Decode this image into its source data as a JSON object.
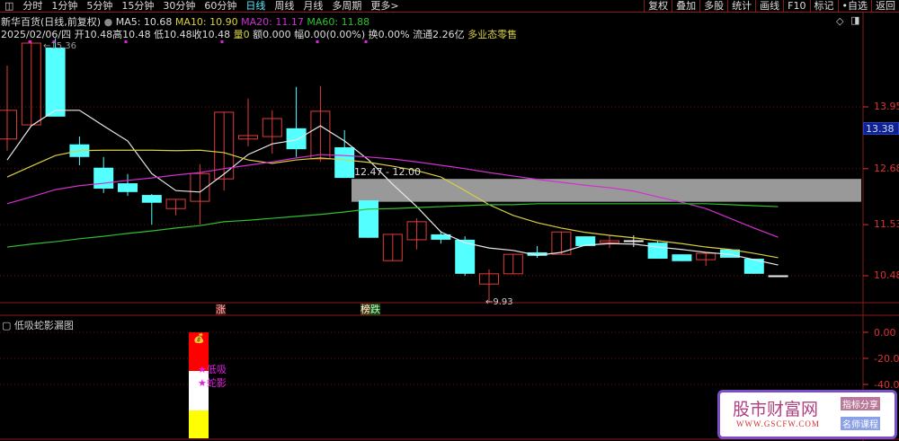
{
  "toolbar": {
    "left": [
      "分时",
      "1分钟",
      "5分钟",
      "15分钟",
      "30分钟",
      "60分钟",
      "日线",
      "周线",
      "月线",
      "多周期",
      "更多>"
    ],
    "active": "日线",
    "right": [
      "复权",
      "叠加",
      "多股",
      "统计",
      "画线",
      "F10",
      "标记",
      "•自选",
      "返回"
    ]
  },
  "header": {
    "title": "新华百货(日线,前复权)",
    "ma5": "MA5: 10.68",
    "ma10": "MA10: 10.90",
    "ma20": "MA20: 11.17",
    "ma60": "MA60: 11.88",
    "date": "2025/02/06/四",
    "open": "开10.48",
    "high": "高10.48",
    "low": "低10.48",
    "close": "收10.48",
    "vol": "量0",
    "amount": "额0.000",
    "range": "幅0.00(0.00%)",
    "turnover": "换0.00%",
    "float": "流通2.26亿",
    "sector": "多业态零售"
  },
  "colors": {
    "up": "#e03c3c",
    "down": "#54ffff",
    "ma5": "#e8e8e8",
    "ma10": "#d8d040",
    "ma20": "#d030d0",
    "ma60": "#30c030",
    "axis": "#d33"
  },
  "chart_data": {
    "type": "candlestick",
    "ylim": [
      9.6,
      15.32
    ],
    "y_ticks": [
      "13.95",
      "12.68",
      "11.53",
      "10.48"
    ],
    "current_price": "13.38",
    "high_label": "15.36",
    "low_label": "9.93",
    "band": {
      "label": "12.47 - 12.00",
      "low": 12.0,
      "high": 12.47
    },
    "ohlc": [
      [
        13.29,
        14.8,
        13.05,
        13.88
      ],
      [
        13.58,
        15.32,
        13.58,
        15.26
      ],
      [
        15.17,
        15.36,
        13.75,
        13.75
      ],
      [
        13.18,
        13.34,
        12.75,
        12.92
      ],
      [
        12.7,
        12.92,
        12.18,
        12.27
      ],
      [
        12.38,
        12.57,
        12.12,
        12.2
      ],
      [
        12.14,
        12.16,
        11.53,
        11.98
      ],
      [
        11.86,
        12.05,
        11.72,
        12.05
      ],
      [
        12.01,
        12.77,
        11.53,
        12.58
      ],
      [
        12.47,
        13.84,
        12.23,
        13.84
      ],
      [
        13.29,
        14.12,
        13.14,
        13.36
      ],
      [
        13.34,
        13.88,
        12.99,
        13.71
      ],
      [
        13.51,
        14.36,
        12.92,
        13.08
      ],
      [
        12.88,
        14.38,
        12.82,
        13.86
      ],
      [
        13.12,
        13.47,
        12.49,
        12.49
      ],
      [
        12.03,
        12.03,
        11.26,
        11.26
      ],
      [
        10.79,
        11.33,
        10.79,
        11.33
      ],
      [
        11.22,
        11.66,
        11.02,
        11.59
      ],
      [
        11.33,
        11.4,
        11.14,
        11.22
      ],
      [
        11.22,
        11.29,
        10.48,
        10.52
      ],
      [
        10.31,
        10.61,
        9.93,
        10.52
      ],
      [
        10.52,
        10.92,
        10.52,
        10.92
      ],
      [
        10.96,
        11.09,
        10.85,
        10.89
      ],
      [
        10.92,
        11.38,
        10.92,
        11.38
      ],
      [
        11.29,
        11.29,
        11.09,
        11.09
      ],
      [
        11.16,
        11.31,
        11.05,
        11.2
      ],
      [
        11.2,
        11.31,
        11.07,
        11.2
      ],
      [
        11.16,
        11.2,
        10.83,
        10.83
      ],
      [
        10.92,
        10.92,
        10.78,
        10.78
      ],
      [
        10.81,
        10.94,
        10.68,
        10.94
      ],
      [
        11.02,
        11.02,
        10.85,
        10.85
      ],
      [
        10.83,
        10.83,
        10.52,
        10.52
      ],
      [
        10.48,
        10.48,
        10.48,
        10.48
      ]
    ],
    "ma5": [
      12.86,
      13.56,
      13.88,
      13.88,
      13.56,
      13.25,
      12.58,
      12.23,
      12.2,
      12.57,
      12.97,
      13.19,
      13.27,
      13.56,
      13.25,
      12.86,
      12.36,
      11.9,
      11.38,
      11.16,
      11.05,
      11.0,
      10.9,
      10.96,
      11.11,
      11.14,
      11.13,
      11.07,
      11.02,
      10.96,
      10.92,
      10.81,
      10.7
    ],
    "ma10": [
      12.51,
      12.73,
      12.95,
      13.05,
      13.06,
      13.06,
      13.06,
      13.05,
      13.06,
      13.01,
      12.86,
      12.79,
      12.86,
      12.9,
      12.86,
      12.81,
      12.73,
      12.64,
      12.51,
      12.23,
      11.94,
      11.72,
      11.57,
      11.46,
      11.37,
      11.31,
      11.26,
      11.2,
      11.14,
      11.07,
      11.02,
      10.94,
      10.85
    ],
    "ma20": [
      11.96,
      12.1,
      12.25,
      12.33,
      12.38,
      12.44,
      12.49,
      12.55,
      12.6,
      12.68,
      12.75,
      12.82,
      12.9,
      12.97,
      12.95,
      12.92,
      12.88,
      12.82,
      12.75,
      12.68,
      12.6,
      12.53,
      12.46,
      12.4,
      12.34,
      12.29,
      12.22,
      12.1,
      11.99,
      11.86,
      11.66,
      11.46,
      11.27
    ],
    "ma60": [
      11.07,
      11.13,
      11.18,
      11.24,
      11.29,
      11.35,
      11.4,
      11.46,
      11.51,
      11.59,
      11.62,
      11.66,
      11.7,
      11.74,
      11.79,
      11.85,
      11.86,
      11.88,
      11.9,
      11.92,
      11.94,
      11.94,
      11.96,
      11.96,
      11.96,
      11.96,
      11.96,
      11.96,
      11.96,
      11.96,
      11.94,
      11.92,
      11.9
    ]
  },
  "markers": {
    "rise": "涨",
    "fall_a": "榜",
    "fall_b": "跌"
  },
  "indicator": {
    "title": "低吸蛇影漏图",
    "ticks": [
      "0.00",
      "-20.00",
      "-40.00"
    ],
    "label1": "低吸",
    "label2": "蛇影"
  },
  "logo": {
    "name": "股市财富网",
    "url": "WWW.GSCFW.COM",
    "tag1": "指标分享",
    "tag2": "名师课程"
  }
}
